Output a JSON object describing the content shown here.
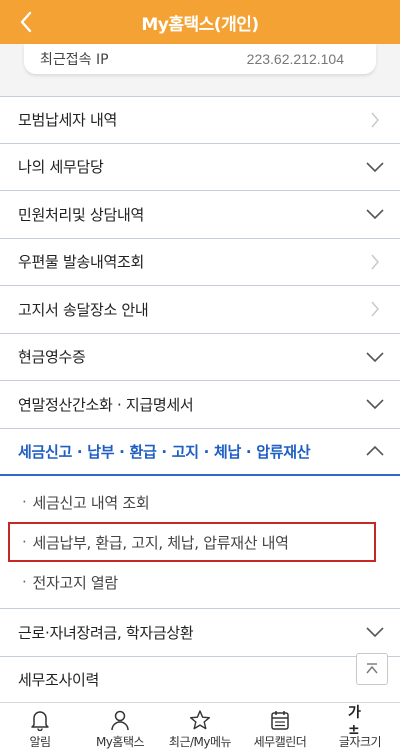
{
  "header": {
    "title": "My홈택스(개인)"
  },
  "ip": {
    "label": "최근접속 IP",
    "value": "223.62.212.104"
  },
  "menu": {
    "items": [
      {
        "label": "모범납세자 내역"
      },
      {
        "label": "나의 세무담당"
      },
      {
        "label": "민원처리및 상담내역"
      },
      {
        "label": "우편물 발송내역조회"
      },
      {
        "label": "고지서 송달장소 안내"
      },
      {
        "label": "현금영수증"
      },
      {
        "label": "연말정산간소화 · 지급명세서"
      },
      {
        "label": "세금신고 · 납부 · 환급 · 고지 · 체납 · 압류재산"
      }
    ],
    "sub_items": [
      {
        "label": "세금신고 내역 조회"
      },
      {
        "label": "세금납부, 환급, 고지, 체납, 압류재산 내역"
      },
      {
        "label": "전자고지 열람"
      }
    ],
    "after": [
      {
        "label": "근로·자녀장려금, 학자금상환"
      },
      {
        "label": "세무조사이력"
      }
    ]
  },
  "bottom_nav": [
    {
      "label": "알림",
      "icon": "bell-icon"
    },
    {
      "label": "My홈택스",
      "icon": "person-icon"
    },
    {
      "label": "최근/My메뉴",
      "icon": "star-icon"
    },
    {
      "label": "세무캘린더",
      "icon": "calendar-icon"
    },
    {
      "label": "글자크기",
      "icon": "font-size-icon",
      "glyph": "가±"
    }
  ],
  "colors": {
    "header": "#f4a233",
    "active": "#1f5fc4",
    "highlight_border": "#c62828"
  }
}
